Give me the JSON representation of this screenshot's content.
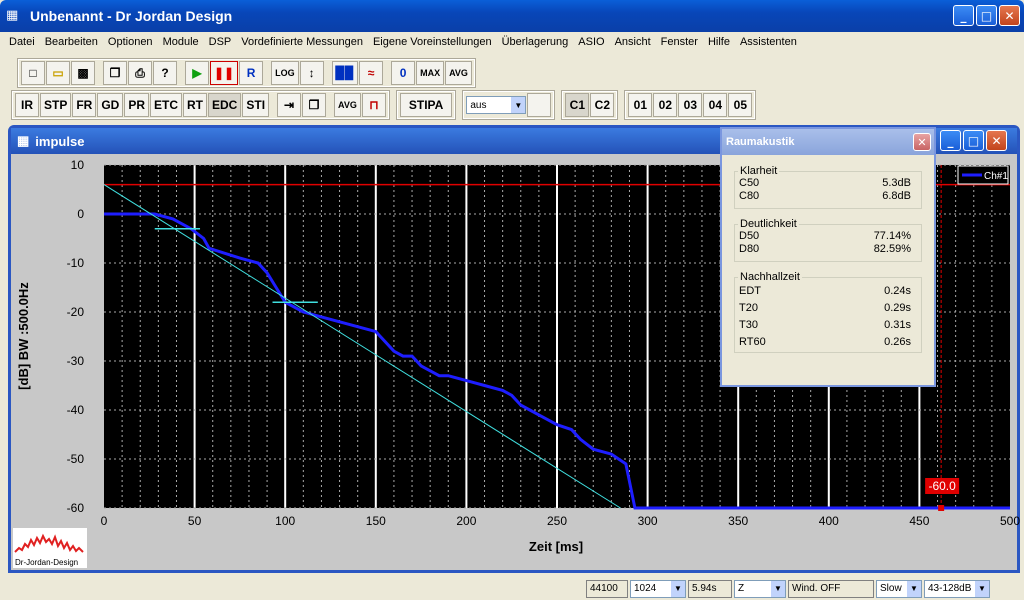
{
  "window": {
    "title": "Unbenannt - Dr Jordan Design"
  },
  "menu": [
    "Datei",
    "Bearbeiten",
    "Optionen",
    "Module",
    "DSP",
    "Vordefinierte Messungen",
    "Eigene Voreinstellungen",
    "Überlagerung",
    "ASIO",
    "Ansicht",
    "Fenster",
    "Hilfe",
    "Assistenten"
  ],
  "toolbar1": {
    "log": "LOG",
    "zero": "0",
    "max": "MAX",
    "avg": "AVG",
    "r": "R"
  },
  "toolbar2": {
    "ir": "IR",
    "stp": "STP",
    "fr": "FR",
    "gd": "GD",
    "pr": "PR",
    "etc": "ETC",
    "rt": "RT",
    "edc": "EDC",
    "sti": "STI",
    "avg": "AVG",
    "stipa": "STIPA",
    "aus": "aus",
    "c1": "C1",
    "c2": "C2",
    "m1": "01",
    "m2": "02",
    "m3": "03",
    "m4": "04",
    "m5": "05"
  },
  "child": {
    "title": "impulse"
  },
  "ra": {
    "title": "Raumakustik",
    "klarheit": {
      "label": "Klarheit",
      "rows": [
        {
          "k": "C50",
          "v": "5.3dB"
        },
        {
          "k": "C80",
          "v": "6.8dB"
        }
      ]
    },
    "deutlichkeit": {
      "label": "Deutlichkeit",
      "rows": [
        {
          "k": "D50",
          "v": "77.14%"
        },
        {
          "k": "D80",
          "v": "82.59%"
        }
      ]
    },
    "nachhall": {
      "label": "Nachhallzeit",
      "rows": [
        {
          "k": "EDT",
          "v": "0.24s"
        },
        {
          "k": "T20",
          "v": "0.29s"
        },
        {
          "k": "T30",
          "v": "0.31s"
        },
        {
          "k": "RT60",
          "v": "0.26s"
        }
      ]
    }
  },
  "logo_text": "Dr-Jordan-Design",
  "status": {
    "rate": "44100",
    "size": "1024",
    "time": "5.94s",
    "weight": "Z",
    "wind": "Wind. OFF",
    "speed": "Slow",
    "band": "43-128dB"
  },
  "chart_data": {
    "type": "line",
    "xlabel": "Zeit [ms]",
    "ylabel": "[dB] BW :500.0Hz",
    "xlim": [
      0,
      500
    ],
    "ylim": [
      -60,
      10
    ],
    "xticks": [
      0,
      50,
      100,
      150,
      200,
      250,
      300,
      350,
      400,
      450,
      500
    ],
    "yticks": [
      10,
      0,
      -10,
      -20,
      -30,
      -40,
      -50,
      -60
    ],
    "legend": "Ch#1",
    "marker_label": "-60.0",
    "marker_x": 462,
    "ref_level": 6,
    "series": [
      {
        "name": "Ch#1",
        "color": "#1e1eff",
        "x": [
          0,
          28,
          38,
          48,
          55,
          58,
          75,
          85,
          90,
          95,
          100,
          110,
          120,
          130,
          150,
          160,
          165,
          170,
          175,
          180,
          185,
          190,
          200,
          210,
          220,
          225,
          230,
          235,
          240,
          245,
          250,
          258,
          263,
          270,
          280,
          288,
          293,
          300,
          500
        ],
        "y": [
          0,
          0,
          -1,
          -3,
          -5,
          -7,
          -9,
          -10,
          -12,
          -15,
          -18,
          -20,
          -21,
          -22,
          -24,
          -28,
          -29,
          -29,
          -31,
          -32,
          -33,
          -33,
          -34,
          -35,
          -36,
          -37,
          -39,
          -40,
          -41,
          -42,
          -43,
          -44,
          -46,
          -48,
          -49,
          -51,
          -60,
          -60,
          -60
        ]
      },
      {
        "name": "",
        "color": "#40e0e0",
        "x": [
          0,
          285
        ],
        "y": [
          6,
          -60
        ]
      }
    ],
    "markers": [
      {
        "x1": 28,
        "x2": 53,
        "y": -3
      },
      {
        "x1": 93,
        "x2": 118,
        "y": -18
      }
    ]
  }
}
